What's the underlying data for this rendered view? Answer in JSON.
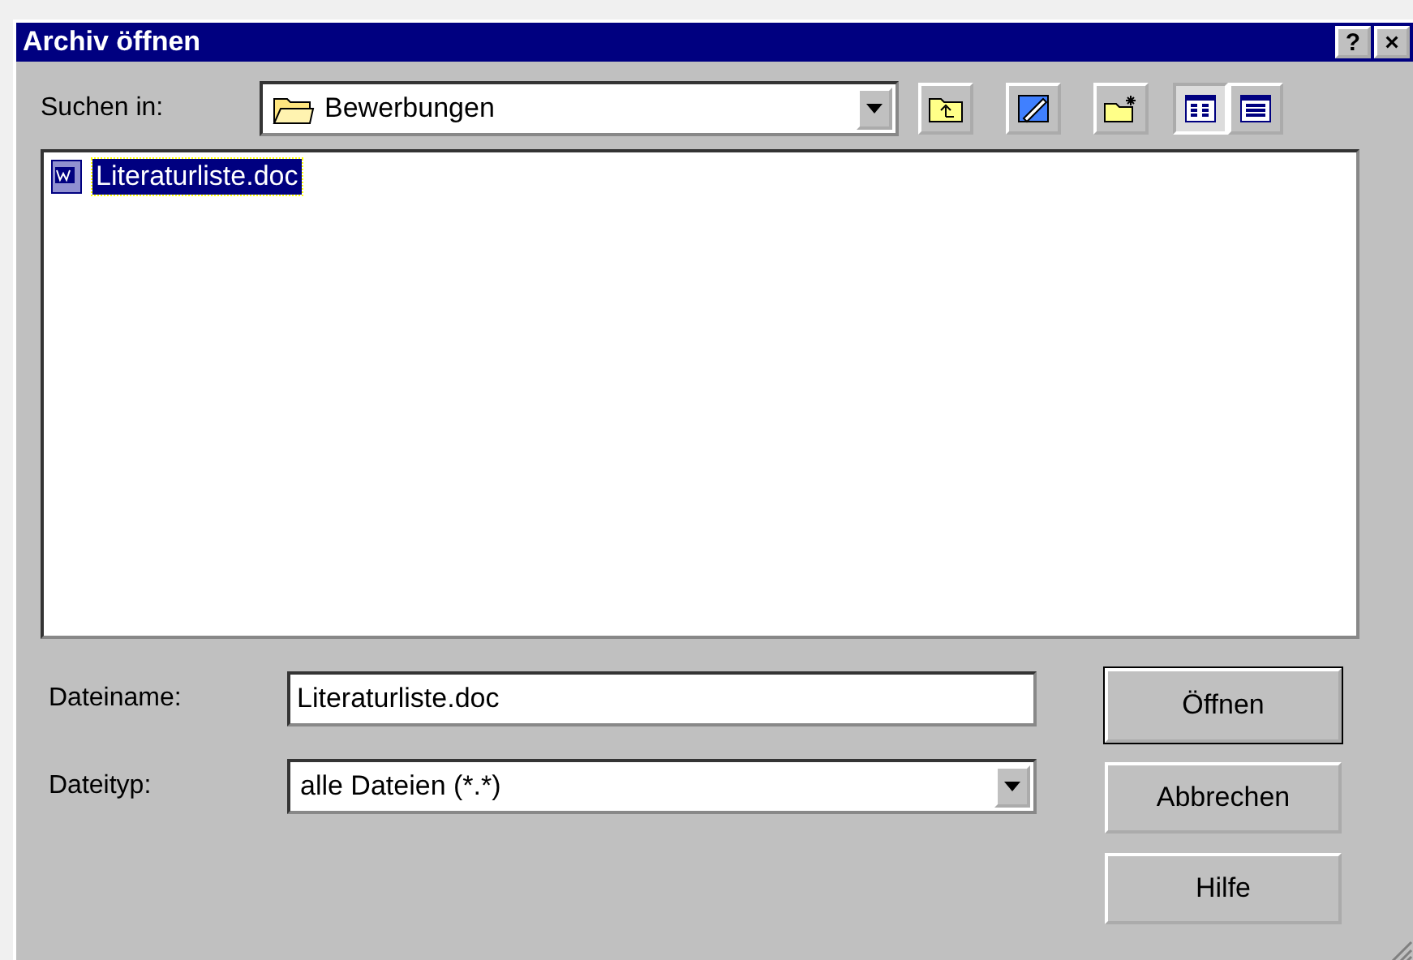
{
  "window": {
    "title": "Archiv öffnen",
    "title_buttons": [
      "?",
      "×"
    ]
  },
  "look_in": {
    "label": "Suchen in:",
    "value": "Bewerbungen"
  },
  "toolbar": [
    {
      "kind": "up",
      "selected": false
    },
    {
      "kind": "desktop",
      "selected": false
    },
    {
      "kind": "newfolder",
      "selected": false
    },
    {
      "kind": "list",
      "selected": true
    },
    {
      "kind": "details",
      "selected": false
    }
  ],
  "files": [
    {
      "name": "Literaturliste.doc",
      "selected": true
    }
  ],
  "filename": {
    "label": "Dateiname:",
    "value": "Literaturliste.doc"
  },
  "filetype": {
    "label": "Dateityp:",
    "value": "alle Dateien (*.*)"
  },
  "buttons": [
    {
      "label": "Öffnen",
      "default": true
    },
    {
      "label": "Abbrechen",
      "default": false
    },
    {
      "label": "Hilfe",
      "default": false
    }
  ]
}
